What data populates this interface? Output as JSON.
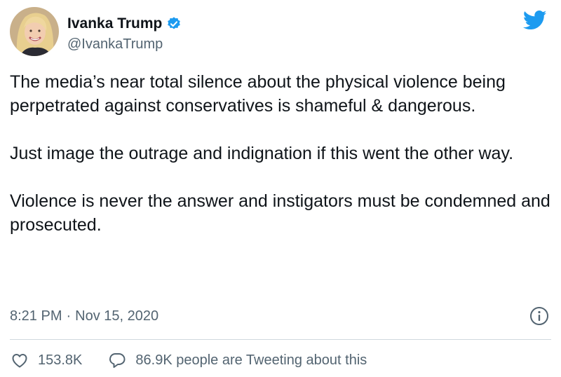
{
  "author": {
    "display_name": "Ivanka Trump",
    "handle": "@IvankaTrump",
    "verified": true,
    "avatar_icon": "profile-photo"
  },
  "tweet": {
    "paragraphs": [
      "The media’s near total silence about the physical violence being perpetrated against conservatives is shameful & dangerous.",
      "Just image the outrage and indignation if this went the other way.",
      "Violence is never the answer and instigators must be condemned and prosecuted."
    ],
    "time": "8:21 PM",
    "separator": "·",
    "date": "Nov 15, 2020"
  },
  "actions": {
    "likes": "153.8K",
    "conversation": "86.9K people are Tweeting about this"
  },
  "colors": {
    "twitter_blue": "#1d9bf0",
    "text": "#0f1419",
    "muted": "#536471",
    "divider": "#cfd9de"
  },
  "icons": {
    "brand": "twitter-bird-icon",
    "verified": "verified-badge-icon",
    "info": "info-icon",
    "like": "heart-icon",
    "reply": "speech-bubble-icon"
  }
}
